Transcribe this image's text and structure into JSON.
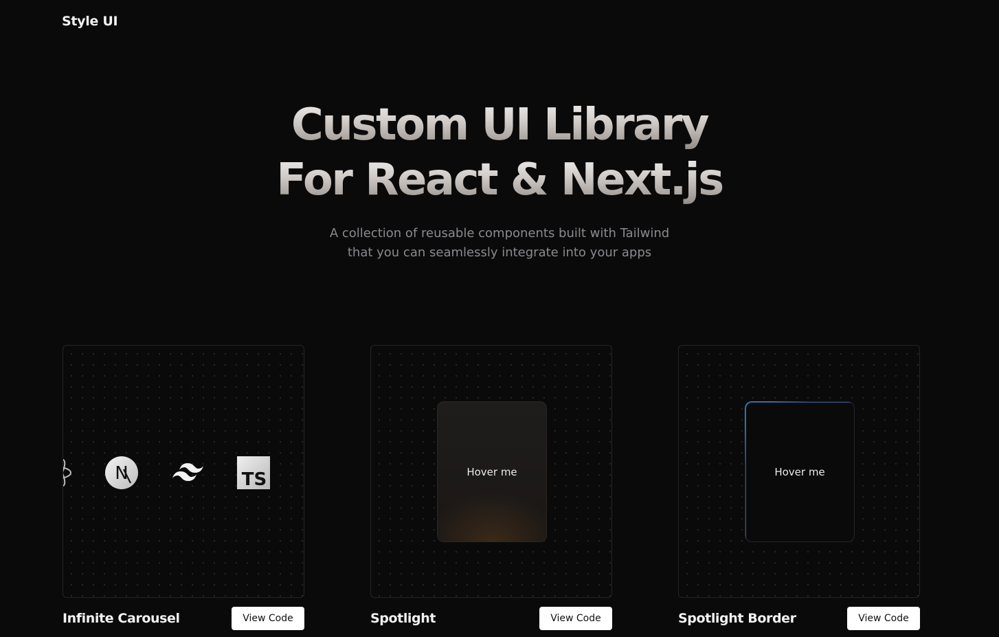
{
  "header": {
    "brand": "Style UI"
  },
  "hero": {
    "title_line1": "Custom UI Library",
    "title_line2": "For React & Next.js",
    "subtitle_line1": "A collection of reusable components built with Tailwind",
    "subtitle_line2": "that you can seamlessly integrate into your apps"
  },
  "cards": [
    {
      "title": "Infinite Carousel",
      "button": "View Code",
      "logos": [
        "react-icon",
        "nextjs-icon",
        "tailwind-icon",
        "typescript-icon"
      ],
      "ts_label": "TS",
      "next_label": "N"
    },
    {
      "title": "Spotlight",
      "button": "View Code",
      "preview_text": "Hover me"
    },
    {
      "title": "Spotlight Border",
      "button": "View Code",
      "preview_text": "Hover me",
      "accent_color": "#3a86d8"
    }
  ]
}
